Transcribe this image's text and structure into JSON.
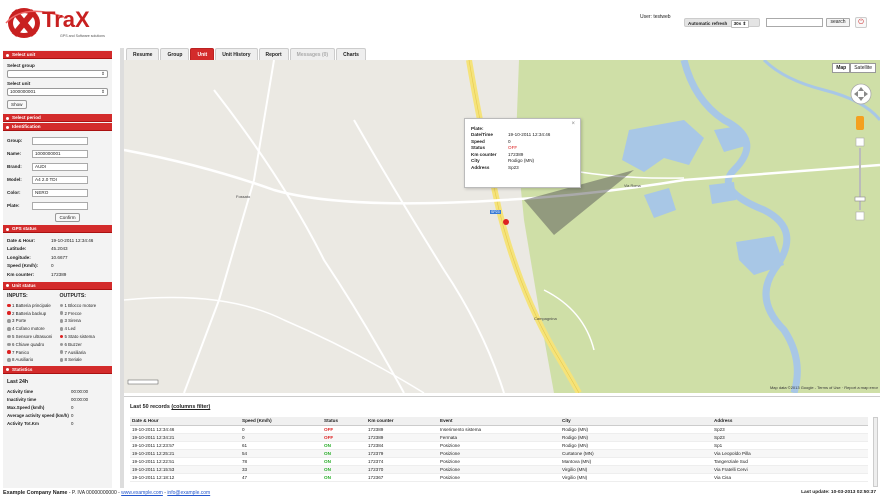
{
  "header": {
    "logo_text": "TraX",
    "logo_tagline": "GPS and Software solutions",
    "user_label": "User: testweb",
    "auto_refresh_label": "Automatic refresh",
    "auto_refresh_value": "30s",
    "search_placeholder": "",
    "search_button": "search",
    "logout_icon": "power-icon"
  },
  "sidebar": {
    "select_unit_title": "Select unit",
    "select_group_label": "Select group",
    "select_group_value": "",
    "select_unit_label": "Select unit",
    "select_unit_value": "1000000001",
    "show_button": "Show",
    "select_period_title": "Select period",
    "identification_title": "Identification",
    "ident": [
      {
        "key": "Group:",
        "value": ""
      },
      {
        "key": "Name:",
        "value": "1000000001"
      },
      {
        "key": "Brand:",
        "value": "AUDI"
      },
      {
        "key": "Model:",
        "value": "A4 2.0 TDI"
      },
      {
        "key": "Color:",
        "value": "NERO"
      },
      {
        "key": "Plate:",
        "value": ""
      }
    ],
    "confirm_button": "Confirm",
    "gps_title": "GPS status",
    "gps": [
      {
        "key": "Date & Hour:",
        "value": "19-10-2011 12:34:46"
      },
      {
        "key": "Latitude:",
        "value": "45.2043"
      },
      {
        "key": "Longitude:",
        "value": "10.6677"
      },
      {
        "key": "Speed (Km/h):",
        "value": "0"
      },
      {
        "key": "Km counter:",
        "value": "172389"
      }
    ],
    "unit_status_title": "Unit status",
    "inputs_label": "INPUTS:",
    "outputs_label": "OUTPUTS:",
    "inputs": [
      {
        "label": "1 Batteria principale",
        "color": "red"
      },
      {
        "label": "2 Batteria backup",
        "color": "red"
      },
      {
        "label": "3 Porte",
        "color": "grey"
      },
      {
        "label": "4 Cofano motore",
        "color": "grey"
      },
      {
        "label": "5 Sensore ultrasuoni",
        "color": "grey"
      },
      {
        "label": "6 Chiave quadro",
        "color": "grey"
      },
      {
        "label": "7 Panico",
        "color": "red"
      },
      {
        "label": "8 Ausiliario",
        "color": "grey"
      }
    ],
    "outputs": [
      {
        "label": "1 Blocco motore",
        "color": "grey"
      },
      {
        "label": "2 Frecce",
        "color": "grey"
      },
      {
        "label": "3 Sirena",
        "color": "grey"
      },
      {
        "label": "4 Led",
        "color": "grey"
      },
      {
        "label": "5 Stato sistema",
        "color": "red"
      },
      {
        "label": "6 Buzzer",
        "color": "grey"
      },
      {
        "label": "7 Ausiliaria",
        "color": "grey"
      },
      {
        "label": "8 Seriale",
        "color": "grey"
      }
    ],
    "statistics_title": "Statistics",
    "last24_label": "Last 24h",
    "stats": [
      {
        "key": "Activity time",
        "value": "00:00:00"
      },
      {
        "key": "Inactivity time",
        "value": "00:00:00"
      },
      {
        "key": "Max.Speed (km/h)",
        "value": "0"
      },
      {
        "key": "Average activity speed (km/h)",
        "value": "0"
      },
      {
        "key": "Activity Tot.Km",
        "value": "0"
      }
    ]
  },
  "tabs": [
    {
      "label": "Resume",
      "state": "normal"
    },
    {
      "label": "Group",
      "state": "normal"
    },
    {
      "label": "Unit",
      "state": "active"
    },
    {
      "label": "Unit History",
      "state": "normal"
    },
    {
      "label": "Report",
      "state": "normal"
    },
    {
      "label": "Messages (0)",
      "state": "disabled"
    },
    {
      "label": "Charts",
      "state": "normal"
    }
  ],
  "map": {
    "type_map": "Map",
    "type_satellite": "Satellite",
    "attribution": "Map data ©2013 Google - Terms of Use · Report a map error",
    "popup": [
      {
        "key": "Plate:",
        "value": ""
      },
      {
        "key": "Date/Time",
        "value": "19-10-2011 12:34:46"
      },
      {
        "key": "Speed",
        "value": "0"
      },
      {
        "key": "Status",
        "value": "OFF"
      },
      {
        "key": "Km counter",
        "value": "172389"
      },
      {
        "key": "City",
        "value": "Rodigo (MN)"
      },
      {
        "key": "Address",
        "value": "Sp23"
      }
    ],
    "labels": [
      {
        "text": "Fossato"
      },
      {
        "text": "Campagnina"
      },
      {
        "text": "SP23"
      },
      {
        "text": "Via Roma"
      }
    ]
  },
  "records": {
    "title": "Last 50 records",
    "filter_link": "(columns filter)",
    "columns": [
      "Date & Hour",
      "Speed (Km/h)",
      "Status",
      "Km counter",
      "Event",
      "City",
      "Address"
    ],
    "rows": [
      [
        "19-10-2011 12:34:46",
        "0",
        "OFF",
        "172389",
        "Inserimento sistema",
        "Rodigo (MN)",
        "Sp23"
      ],
      [
        "19-10-2011 12:34:21",
        "0",
        "OFF",
        "172389",
        "Fermata",
        "Rodigo (MN)",
        "Sp23"
      ],
      [
        "19-10-2011 12:23:57",
        "61",
        "ON",
        "172384",
        "Posizione",
        "Rodigo (MN)",
        "Sp1"
      ],
      [
        "19-10-2011 12:25:21",
        "54",
        "ON",
        "172379",
        "Posizione",
        "Curtatone (MN)",
        "Via Leopoldo Pilla"
      ],
      [
        "19-10-2011 12:22:51",
        "78",
        "ON",
        "172374",
        "Posizione",
        "Mantova (MN)",
        "Tangenziale Sud"
      ],
      [
        "19-10-2011 12:15:53",
        "33",
        "ON",
        "172370",
        "Posizione",
        "Virgilio (MN)",
        "Via Fratelli Cervi"
      ],
      [
        "19-10-2011 12:18:12",
        "47",
        "ON",
        "172367",
        "Posizione",
        "Virgilio (MN)",
        "Via Cisa"
      ]
    ]
  },
  "footer": {
    "company": "Example Company Name",
    "vat": "- P. IVA 00000000000 -",
    "website": "www.example.com",
    "email": "info@example.com",
    "last_update": "Last update: 10-03-2013 02:50:37"
  },
  "colors": {
    "accent": "#d32b2b",
    "map_green": "#c8dba0",
    "river": "#9cc0e8"
  }
}
